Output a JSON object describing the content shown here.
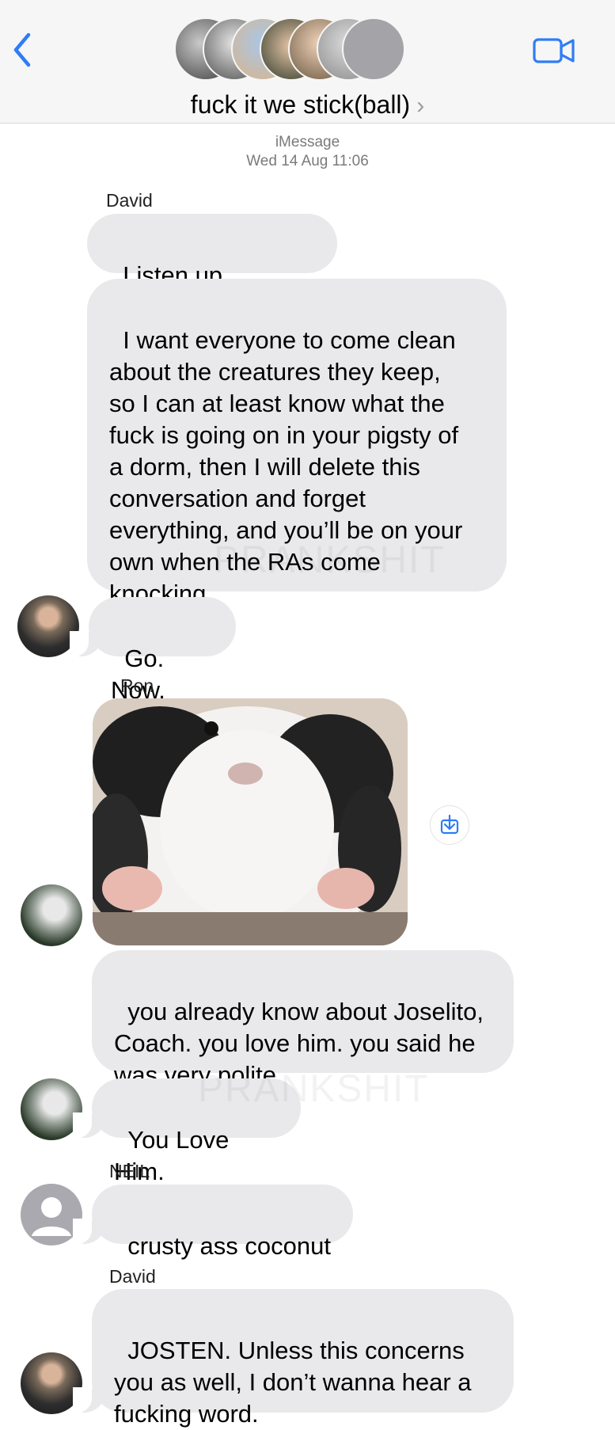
{
  "header": {
    "title": "fuck it we stick(ball)",
    "chevron": "›",
    "back_icon": "chevron-left-icon",
    "video_icon": "video-camera-icon",
    "accent": "#2f7cf6"
  },
  "meta": {
    "service": "iMessage",
    "timestamp": "Wed 14 Aug 11:06"
  },
  "watermark": "PRANKSHIT",
  "messages": {
    "m1": {
      "sender": "David",
      "text": "Listen up, dipshits"
    },
    "m2": {
      "text": "I want everyone to come clean\nabout the creatures they keep,\nso I can at least know what the\nfuck is going on in your pigsty of\na dorm, then I will delete this\nconversation and forget\neverything, and you’ll be on your\nown when the RAs come\nknocking."
    },
    "m3": {
      "text": "Go. Now."
    },
    "m4": {
      "sender": "Ron",
      "attachment": "guinea-pig-photo"
    },
    "m5": {
      "text": "you already know about Joselito,\nCoach. you love him. you said he\nwas very polite."
    },
    "m6": {
      "text": "You Love Him."
    },
    "m7": {
      "sender": "NEIL",
      "text": "crusty ass coconut"
    },
    "m8": {
      "sender": "David",
      "text": "JOSTEN. Unless this concerns\nyou as well, I don’t wanna hear a\nfucking word."
    }
  },
  "colors": {
    "bubble": "#e9e9eb",
    "header_bg": "#f6f6f6",
    "meta_text": "#7a7a7a"
  }
}
